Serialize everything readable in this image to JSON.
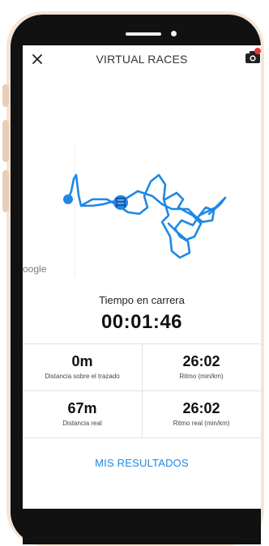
{
  "header": {
    "title": "VIRTUAL RACES",
    "close_icon": "close-icon",
    "camera_icon": "camera-icon"
  },
  "map": {
    "attribution": "oogle",
    "route_color": "#1e88e5",
    "markers": [
      "start-marker",
      "finish-flag-marker"
    ]
  },
  "race": {
    "time_label": "Tiempo en carrera",
    "time_value": "00:01:46"
  },
  "stats": [
    {
      "value": "0m",
      "label": "Distancia sobre el trazado"
    },
    {
      "value": "26:02",
      "label": "Ritmo (min/km)"
    },
    {
      "value": "67m",
      "label": "Distancia real"
    },
    {
      "value": "26:02",
      "label": "Ritmo real (min/km)"
    }
  ],
  "actions": {
    "results_label": "MIS RESULTADOS"
  },
  "colors": {
    "accent": "#1e88e5",
    "frame": "#f6e5d6",
    "bezel": "#111111",
    "badge": "#e53935"
  }
}
